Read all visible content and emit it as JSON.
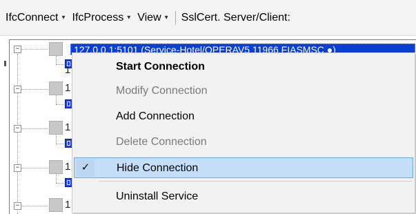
{
  "toolbar": {
    "menus": [
      {
        "label": "IfcConnect"
      },
      {
        "label": "IfcProcess"
      },
      {
        "label": "View"
      }
    ],
    "ssl_label": "SslCert. Server/Client:",
    "caret_glyph": "▾"
  },
  "tree": {
    "selected_row_text": "127.0.0.1:5101 (Service-Hotel/OPERAV5 11966 FIASMSC ●)",
    "rows": [
      {
        "partial_label": "1"
      },
      {
        "partial_label": "1"
      },
      {
        "partial_label": "1"
      },
      {
        "partial_label": "1"
      },
      {
        "partial_label": "1"
      }
    ],
    "expander_glyph": "−"
  },
  "context_menu": {
    "items": [
      {
        "label": "Start Connection",
        "bold": true,
        "disabled": false,
        "checked": false
      },
      {
        "label": "Modify Connection",
        "bold": false,
        "disabled": true,
        "checked": false
      },
      {
        "label": "Add Connection",
        "bold": false,
        "disabled": false,
        "checked": false
      },
      {
        "label": "Delete Connection",
        "bold": false,
        "disabled": true,
        "checked": false
      },
      {
        "label": "Hide Connection",
        "bold": false,
        "disabled": false,
        "checked": true,
        "highlighted": true
      },
      {
        "label": "Uninstall Service",
        "bold": false,
        "disabled": false,
        "checked": false
      }
    ],
    "check_glyph": "✓"
  },
  "colors": {
    "selection_blue": "#0b3fd0",
    "menu_highlight": "#c5dff9",
    "disabled_text": "#7a7a7a"
  }
}
